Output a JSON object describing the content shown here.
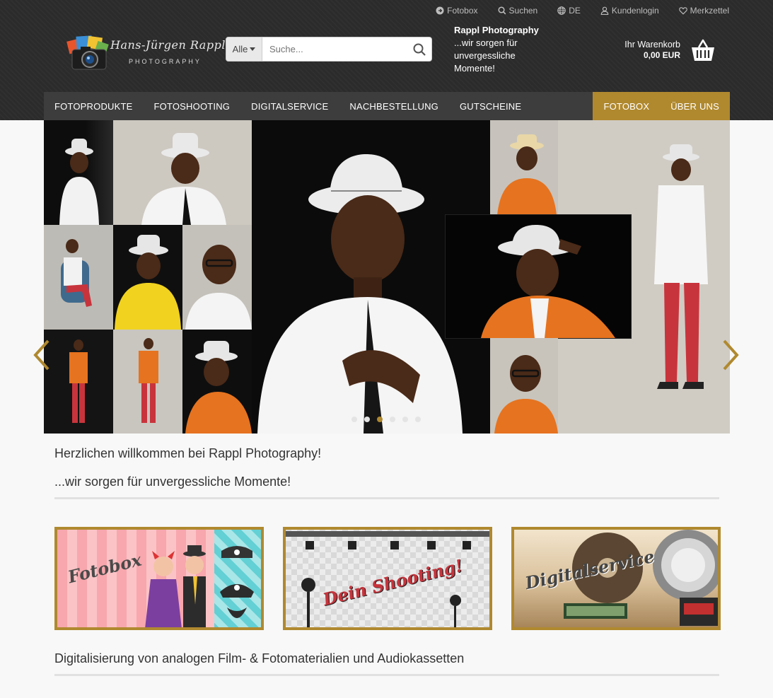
{
  "topbar": {
    "fotobox": "Fotobox",
    "search": "Suchen",
    "language": "DE",
    "login": "Kundenlogin",
    "wishlist": "Merkzettel"
  },
  "logo": {
    "name": "Hans-Jürgen Rappl",
    "sub": "PHOTOGRAPHY"
  },
  "search": {
    "category": "Alle",
    "placeholder": "Suche..."
  },
  "slogan": {
    "title": "Rappl Photography",
    "text": "...wir sorgen für unvergessliche Momente!"
  },
  "cart": {
    "label": "Ihr Warenkorb",
    "amount": "0,00 EUR"
  },
  "nav": {
    "items": [
      "FOTOPRODUKTE",
      "FOTOSHOOTING",
      "DIGITALSERVICE",
      "NACHBESTELLUNG",
      "GUTSCHEINE"
    ],
    "right": [
      "FOTOBOX",
      "ÜBER UNS"
    ]
  },
  "slider": {
    "active_index": 2,
    "count": 6
  },
  "content": {
    "welcome": "Herzlichen willkommen bei Rappl Photography!",
    "tagline": "...wir sorgen für unvergessliche Momente!",
    "banners": [
      "Fotobox",
      "Dein Shooting!",
      "Digitalservice"
    ],
    "section_title": "Digitalisierung von analogen Film- & Fotomaterialien und Audiokassetten"
  },
  "colors": {
    "accent": "#b0892f",
    "header": "#2b2b2b",
    "nav": "#3d3d3d"
  }
}
